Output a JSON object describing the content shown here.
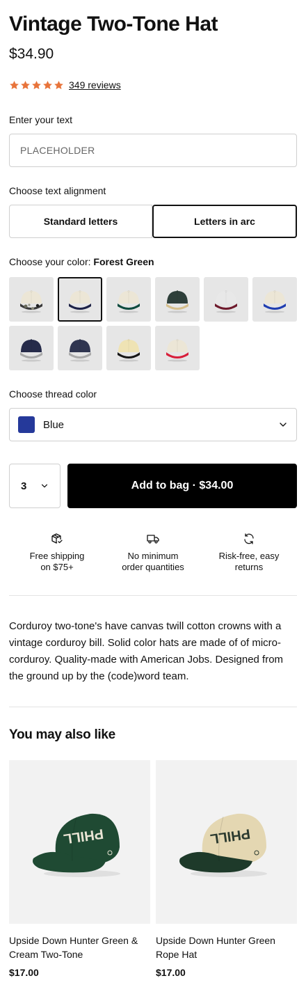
{
  "product": {
    "title": "Vintage Two-Tone Hat",
    "price": "$34.90",
    "rating_stars": 5,
    "star_color": "#e8743b",
    "reviews": "349 reviews"
  },
  "text_field": {
    "label": "Enter your text",
    "placeholder": "PLACEHOLDER"
  },
  "alignment": {
    "label": "Choose text alignment",
    "options": [
      "Standard letters",
      "Letters in arc"
    ],
    "selected": "Letters in arc"
  },
  "color": {
    "label": "Choose your color:",
    "selected_name": "Forest Green",
    "swatches": [
      {
        "crown": "#ece6d6",
        "brim": "#3b3b3b",
        "pattern": "camo"
      },
      {
        "crown": "#ece6d6",
        "brim": "#1e2347",
        "selected": true
      },
      {
        "crown": "#ece6d6",
        "brim": "#0f4b3e"
      },
      {
        "crown": "#2e3f3a",
        "brim": "#d5bf8c"
      },
      {
        "crown": "#e8e8e8",
        "brim": "#6e1a2c"
      },
      {
        "crown": "#ece6d6",
        "brim": "#1f3db0"
      },
      {
        "crown": "#262b4a",
        "brim": "#a9a9a9"
      },
      {
        "crown": "#2f3550",
        "brim": "#a9a9a9"
      },
      {
        "crown": "#efe3b4",
        "brim": "#161616"
      },
      {
        "crown": "#ece6d6",
        "brim": "#d81f3a"
      }
    ]
  },
  "thread": {
    "label": "Choose thread color",
    "value": "Blue",
    "chip_color": "#25399a"
  },
  "cart": {
    "quantity": "3",
    "add_label": "Add to bag · $34.00"
  },
  "perks": [
    {
      "icon": "package-check-icon",
      "text": "Free shipping\non $75+"
    },
    {
      "icon": "truck-icon",
      "text": "No minimum\norder quantities"
    },
    {
      "icon": "refresh-icon",
      "text": "Risk-free, easy\nreturns"
    }
  ],
  "description": "Corduroy two-tone's have canvas twill cotton crowns with a vintage corduroy bill. Solid color hats are made of of micro-corduroy.  Quality-made with American Jobs.  Designed from the ground up by the (code)word team.",
  "related": {
    "heading": "You may also like",
    "items": [
      {
        "name": "Upside Down Hunter Green & Cream Two-Tone",
        "price": "$17.00",
        "crown": "#1f4a33",
        "brim": "#1f4a33",
        "text_color": "#e9e4d4"
      },
      {
        "name": "Upside Down Hunter Green Rope Hat",
        "price": "$17.00",
        "crown": "#e4d7b2",
        "brim": "#1e3a2a",
        "text_color": "#2b3a2f"
      }
    ]
  }
}
